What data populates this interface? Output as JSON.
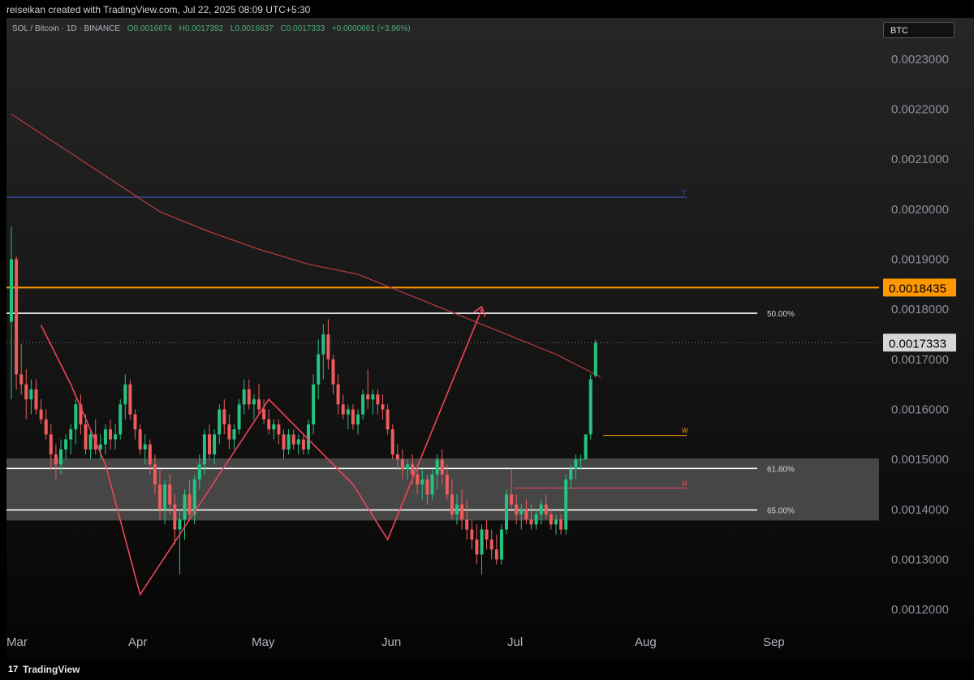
{
  "header": {
    "attribution": "reiseikan created with TradingView.com, Jul 22, 2025 08:09 UTC+5:30"
  },
  "legend": {
    "symbol": "SOL / Bitcoin · 1D · BINANCE",
    "open": "O0.0016674",
    "high": "H0.0017392",
    "low": "L0.0016637",
    "close": "C0.0017333",
    "change": "+0.0000661 (+3.96%)"
  },
  "currency_badge": "BTC",
  "footer": {
    "brand": "TradingView",
    "logo_glyph": "17"
  },
  "colors": {
    "up": "#26c281",
    "down": "#ef5c5c",
    "zone": "#5a5a5a",
    "orange": "#ff9800",
    "blue": "#3f5bd8",
    "pattern": "#f0435a",
    "ma": "#b33a3a"
  },
  "chart_data": {
    "type": "candlestick",
    "x_ticks": [
      "Mar",
      "Apr",
      "May",
      "Jun",
      "Jul",
      "Aug",
      "Sep"
    ],
    "y_ticks": [
      "0.0012000",
      "0.0013000",
      "0.0014000",
      "0.0015000",
      "0.0016000",
      "0.0017000",
      "0.0018000",
      "0.0019000",
      "0.0020000",
      "0.0021000",
      "0.0022000",
      "0.0023000"
    ],
    "y_values": [
      0.0012,
      0.0013,
      0.0014,
      0.0015,
      0.0016,
      0.0017,
      0.0018,
      0.0019,
      0.002,
      0.0021,
      0.0022,
      0.0023
    ],
    "ylim": [
      0.00115,
      0.00235
    ],
    "grid": false,
    "price_badges": [
      {
        "label": "0.0018435",
        "value": 0.0018435,
        "kind": "orange"
      },
      {
        "label": "0.0017333",
        "value": 0.0017333,
        "kind": "current"
      }
    ],
    "support_zone": {
      "from": 0.001378,
      "to": 0.001502
    },
    "fib_levels": [
      {
        "label": "50.00%",
        "value": 0.001792
      },
      {
        "label": "61.80%",
        "value": 0.001482
      },
      {
        "label": "65.00%",
        "value": 0.001399
      }
    ],
    "horizontal_levels": [
      {
        "label": "Y",
        "value": 0.002024,
        "kind": "blue"
      },
      {
        "label": "W",
        "value": 0.001548,
        "kind": "orange"
      },
      {
        "label": "M",
        "value": 0.001443,
        "kind": "red"
      }
    ],
    "candles": [
      {
        "o": 0.001775,
        "h": 0.001965,
        "l": 0.00162,
        "c": 0.0019
      },
      {
        "o": 0.0019,
        "h": 0.001905,
        "l": 0.00164,
        "c": 0.00167
      },
      {
        "o": 0.00167,
        "h": 0.00173,
        "l": 0.00163,
        "c": 0.00165
      },
      {
        "o": 0.00165,
        "h": 0.00168,
        "l": 0.00158,
        "c": 0.00162
      },
      {
        "o": 0.00162,
        "h": 0.00166,
        "l": 0.00159,
        "c": 0.00164
      },
      {
        "o": 0.00164,
        "h": 0.00166,
        "l": 0.00159,
        "c": 0.0016
      },
      {
        "o": 0.0016,
        "h": 0.00162,
        "l": 0.00157,
        "c": 0.00158
      },
      {
        "o": 0.00158,
        "h": 0.0016,
        "l": 0.00154,
        "c": 0.00155
      },
      {
        "o": 0.00155,
        "h": 0.00157,
        "l": 0.00148,
        "c": 0.00151
      },
      {
        "o": 0.00151,
        "h": 0.00153,
        "l": 0.00146,
        "c": 0.00149
      },
      {
        "o": 0.00149,
        "h": 0.00154,
        "l": 0.00147,
        "c": 0.00152
      },
      {
        "o": 0.00152,
        "h": 0.00155,
        "l": 0.0015,
        "c": 0.00154
      },
      {
        "o": 0.00154,
        "h": 0.00157,
        "l": 0.00151,
        "c": 0.00156
      },
      {
        "o": 0.00156,
        "h": 0.00162,
        "l": 0.00153,
        "c": 0.00161
      },
      {
        "o": 0.00161,
        "h": 0.00163,
        "l": 0.00155,
        "c": 0.00157
      },
      {
        "o": 0.00157,
        "h": 0.00159,
        "l": 0.00151,
        "c": 0.00152
      },
      {
        "o": 0.00152,
        "h": 0.00156,
        "l": 0.0015,
        "c": 0.00155
      },
      {
        "o": 0.00155,
        "h": 0.00158,
        "l": 0.00151,
        "c": 0.00152
      },
      {
        "o": 0.00152,
        "h": 0.00155,
        "l": 0.0015,
        "c": 0.00153
      },
      {
        "o": 0.00153,
        "h": 0.00157,
        "l": 0.00151,
        "c": 0.00156
      },
      {
        "o": 0.00156,
        "h": 0.00158,
        "l": 0.00152,
        "c": 0.00154
      },
      {
        "o": 0.00154,
        "h": 0.00157,
        "l": 0.00152,
        "c": 0.00155
      },
      {
        "o": 0.00155,
        "h": 0.00162,
        "l": 0.00154,
        "c": 0.00161
      },
      {
        "o": 0.00161,
        "h": 0.00167,
        "l": 0.00158,
        "c": 0.00165
      },
      {
        "o": 0.00165,
        "h": 0.00166,
        "l": 0.00158,
        "c": 0.00159
      },
      {
        "o": 0.00159,
        "h": 0.0016,
        "l": 0.00154,
        "c": 0.00156
      },
      {
        "o": 0.00156,
        "h": 0.00157,
        "l": 0.00151,
        "c": 0.00152
      },
      {
        "o": 0.00152,
        "h": 0.00155,
        "l": 0.00149,
        "c": 0.00153
      },
      {
        "o": 0.00153,
        "h": 0.00154,
        "l": 0.00147,
        "c": 0.00149
      },
      {
        "o": 0.00149,
        "h": 0.00151,
        "l": 0.00143,
        "c": 0.00145
      },
      {
        "o": 0.00145,
        "h": 0.00148,
        "l": 0.00138,
        "c": 0.0014
      },
      {
        "o": 0.0014,
        "h": 0.00146,
        "l": 0.00137,
        "c": 0.00145
      },
      {
        "o": 0.00145,
        "h": 0.00147,
        "l": 0.00139,
        "c": 0.00141
      },
      {
        "o": 0.00141,
        "h": 0.00143,
        "l": 0.00133,
        "c": 0.00136
      },
      {
        "o": 0.00136,
        "h": 0.0014,
        "l": 0.00127,
        "c": 0.00138
      },
      {
        "o": 0.00138,
        "h": 0.00144,
        "l": 0.00134,
        "c": 0.00143
      },
      {
        "o": 0.00143,
        "h": 0.00146,
        "l": 0.00138,
        "c": 0.00139
      },
      {
        "o": 0.00139,
        "h": 0.00147,
        "l": 0.00137,
        "c": 0.00146
      },
      {
        "o": 0.00146,
        "h": 0.00151,
        "l": 0.00144,
        "c": 0.00149
      },
      {
        "o": 0.00149,
        "h": 0.00156,
        "l": 0.00147,
        "c": 0.00155
      },
      {
        "o": 0.00155,
        "h": 0.00157,
        "l": 0.0015,
        "c": 0.00151
      },
      {
        "o": 0.00151,
        "h": 0.00156,
        "l": 0.00149,
        "c": 0.00155
      },
      {
        "o": 0.00155,
        "h": 0.00161,
        "l": 0.00153,
        "c": 0.0016
      },
      {
        "o": 0.0016,
        "h": 0.00162,
        "l": 0.00155,
        "c": 0.00157
      },
      {
        "o": 0.00157,
        "h": 0.00159,
        "l": 0.00152,
        "c": 0.00154
      },
      {
        "o": 0.00154,
        "h": 0.00157,
        "l": 0.00152,
        "c": 0.00156
      },
      {
        "o": 0.00156,
        "h": 0.00162,
        "l": 0.00155,
        "c": 0.00161
      },
      {
        "o": 0.00161,
        "h": 0.00166,
        "l": 0.00159,
        "c": 0.00164
      },
      {
        "o": 0.00164,
        "h": 0.00166,
        "l": 0.0016,
        "c": 0.00161
      },
      {
        "o": 0.00161,
        "h": 0.00163,
        "l": 0.00158,
        "c": 0.00162
      },
      {
        "o": 0.00162,
        "h": 0.00165,
        "l": 0.00159,
        "c": 0.0016
      },
      {
        "o": 0.0016,
        "h": 0.00162,
        "l": 0.00157,
        "c": 0.00158
      },
      {
        "o": 0.00158,
        "h": 0.0016,
        "l": 0.00155,
        "c": 0.00156
      },
      {
        "o": 0.00156,
        "h": 0.00158,
        "l": 0.00154,
        "c": 0.00157
      },
      {
        "o": 0.00157,
        "h": 0.00158,
        "l": 0.00153,
        "c": 0.00155
      },
      {
        "o": 0.00155,
        "h": 0.00156,
        "l": 0.0015,
        "c": 0.00152
      },
      {
        "o": 0.00152,
        "h": 0.00156,
        "l": 0.00151,
        "c": 0.00155
      },
      {
        "o": 0.00155,
        "h": 0.00156,
        "l": 0.00152,
        "c": 0.00153
      },
      {
        "o": 0.00153,
        "h": 0.00155,
        "l": 0.00151,
        "c": 0.00154
      },
      {
        "o": 0.00154,
        "h": 0.00155,
        "l": 0.00151,
        "c": 0.00152
      },
      {
        "o": 0.00152,
        "h": 0.00158,
        "l": 0.00151,
        "c": 0.00157
      },
      {
        "o": 0.00157,
        "h": 0.00167,
        "l": 0.00155,
        "c": 0.00165
      },
      {
        "o": 0.00165,
        "h": 0.00174,
        "l": 0.00162,
        "c": 0.00171
      },
      {
        "o": 0.00171,
        "h": 0.00177,
        "l": 0.00166,
        "c": 0.00175
      },
      {
        "o": 0.00175,
        "h": 0.00178,
        "l": 0.00168,
        "c": 0.0017
      },
      {
        "o": 0.0017,
        "h": 0.00171,
        "l": 0.00163,
        "c": 0.00165
      },
      {
        "o": 0.00165,
        "h": 0.00167,
        "l": 0.00159,
        "c": 0.00161
      },
      {
        "o": 0.00161,
        "h": 0.00163,
        "l": 0.00158,
        "c": 0.00159
      },
      {
        "o": 0.00159,
        "h": 0.00161,
        "l": 0.00156,
        "c": 0.0016
      },
      {
        "o": 0.0016,
        "h": 0.00161,
        "l": 0.00156,
        "c": 0.00157
      },
      {
        "o": 0.00157,
        "h": 0.0016,
        "l": 0.00155,
        "c": 0.00159
      },
      {
        "o": 0.00159,
        "h": 0.00164,
        "l": 0.00158,
        "c": 0.00163
      },
      {
        "o": 0.00163,
        "h": 0.00168,
        "l": 0.0016,
        "c": 0.00162
      },
      {
        "o": 0.00162,
        "h": 0.00164,
        "l": 0.00159,
        "c": 0.00163
      },
      {
        "o": 0.00163,
        "h": 0.00164,
        "l": 0.00159,
        "c": 0.00161
      },
      {
        "o": 0.00161,
        "h": 0.00163,
        "l": 0.00158,
        "c": 0.0016
      },
      {
        "o": 0.0016,
        "h": 0.00161,
        "l": 0.00155,
        "c": 0.00156
      },
      {
        "o": 0.00156,
        "h": 0.00157,
        "l": 0.0015,
        "c": 0.00151
      },
      {
        "o": 0.00151,
        "h": 0.00153,
        "l": 0.00148,
        "c": 0.0015
      },
      {
        "o": 0.0015,
        "h": 0.00152,
        "l": 0.00146,
        "c": 0.00148
      },
      {
        "o": 0.00148,
        "h": 0.0015,
        "l": 0.00146,
        "c": 0.00149
      },
      {
        "o": 0.00149,
        "h": 0.00151,
        "l": 0.00145,
        "c": 0.00147
      },
      {
        "o": 0.00147,
        "h": 0.00149,
        "l": 0.00143,
        "c": 0.00145
      },
      {
        "o": 0.00145,
        "h": 0.00148,
        "l": 0.00142,
        "c": 0.00146
      },
      {
        "o": 0.00146,
        "h": 0.00147,
        "l": 0.00141,
        "c": 0.00143
      },
      {
        "o": 0.00143,
        "h": 0.00148,
        "l": 0.00142,
        "c": 0.00147
      },
      {
        "o": 0.00147,
        "h": 0.00151,
        "l": 0.00144,
        "c": 0.0015
      },
      {
        "o": 0.0015,
        "h": 0.00152,
        "l": 0.00145,
        "c": 0.00147
      },
      {
        "o": 0.00147,
        "h": 0.00149,
        "l": 0.00142,
        "c": 0.00143
      },
      {
        "o": 0.00143,
        "h": 0.00146,
        "l": 0.00138,
        "c": 0.00139
      },
      {
        "o": 0.00139,
        "h": 0.00143,
        "l": 0.00137,
        "c": 0.00141
      },
      {
        "o": 0.00141,
        "h": 0.00144,
        "l": 0.00136,
        "c": 0.00138
      },
      {
        "o": 0.00138,
        "h": 0.00142,
        "l": 0.00134,
        "c": 0.00136
      },
      {
        "o": 0.00136,
        "h": 0.00138,
        "l": 0.00132,
        "c": 0.00134
      },
      {
        "o": 0.00134,
        "h": 0.00137,
        "l": 0.00129,
        "c": 0.00131
      },
      {
        "o": 0.00131,
        "h": 0.00137,
        "l": 0.00127,
        "c": 0.00136
      },
      {
        "o": 0.00136,
        "h": 0.00138,
        "l": 0.00132,
        "c": 0.00134
      },
      {
        "o": 0.00134,
        "h": 0.00136,
        "l": 0.0013,
        "c": 0.00132
      },
      {
        "o": 0.00132,
        "h": 0.00135,
        "l": 0.00129,
        "c": 0.0013
      },
      {
        "o": 0.0013,
        "h": 0.00137,
        "l": 0.00129,
        "c": 0.00136
      },
      {
        "o": 0.00136,
        "h": 0.00144,
        "l": 0.00135,
        "c": 0.00143
      },
      {
        "o": 0.00143,
        "h": 0.00148,
        "l": 0.0014,
        "c": 0.00141
      },
      {
        "o": 0.00141,
        "h": 0.00143,
        "l": 0.00137,
        "c": 0.00139
      },
      {
        "o": 0.00139,
        "h": 0.00141,
        "l": 0.00136,
        "c": 0.0014
      },
      {
        "o": 0.0014,
        "h": 0.00142,
        "l": 0.00137,
        "c": 0.00138
      },
      {
        "o": 0.00138,
        "h": 0.00141,
        "l": 0.00136,
        "c": 0.00137
      },
      {
        "o": 0.00137,
        "h": 0.0014,
        "l": 0.00136,
        "c": 0.00139
      },
      {
        "o": 0.00139,
        "h": 0.00142,
        "l": 0.00137,
        "c": 0.00141
      },
      {
        "o": 0.00141,
        "h": 0.00143,
        "l": 0.00138,
        "c": 0.00139
      },
      {
        "o": 0.00139,
        "h": 0.0014,
        "l": 0.00136,
        "c": 0.00137
      },
      {
        "o": 0.00137,
        "h": 0.00139,
        "l": 0.00135,
        "c": 0.00138
      },
      {
        "o": 0.00138,
        "h": 0.00139,
        "l": 0.00135,
        "c": 0.00136
      },
      {
        "o": 0.00136,
        "h": 0.00147,
        "l": 0.00135,
        "c": 0.00146
      },
      {
        "o": 0.00146,
        "h": 0.00149,
        "l": 0.00144,
        "c": 0.00148
      },
      {
        "o": 0.00148,
        "h": 0.00151,
        "l": 0.00146,
        "c": 0.0015
      },
      {
        "o": 0.0015,
        "h": 0.00151,
        "l": 0.00148,
        "c": 0.0015
      },
      {
        "o": 0.0015,
        "h": 0.00155,
        "l": 0.0015,
        "c": 0.00155
      },
      {
        "o": 0.00155,
        "h": 0.00167,
        "l": 0.00154,
        "c": 0.00166
      },
      {
        "o": 0.0016674,
        "h": 0.0017392,
        "l": 0.0016637,
        "c": 0.0017333
      }
    ],
    "moving_average": [
      [
        0,
        0.00219
      ],
      [
        10,
        0.002125
      ],
      [
        20,
        0.00206
      ],
      [
        30,
        0.001995
      ],
      [
        40,
        0.001955
      ],
      [
        50,
        0.00192
      ],
      [
        60,
        0.00189
      ],
      [
        70,
        0.00187
      ],
      [
        80,
        0.00183
      ],
      [
        90,
        0.00179
      ],
      [
        100,
        0.00175
      ],
      [
        110,
        0.00171
      ],
      [
        119,
        0.001665
      ]
    ],
    "pattern_path": [
      [
        6,
        0.001768
      ],
      [
        12,
        0.00165
      ],
      [
        19,
        0.00149
      ],
      [
        26,
        0.00123
      ],
      [
        52,
        0.00162
      ],
      [
        69,
        0.00145
      ],
      [
        76,
        0.00134
      ],
      [
        95,
        0.0018
      ]
    ]
  }
}
